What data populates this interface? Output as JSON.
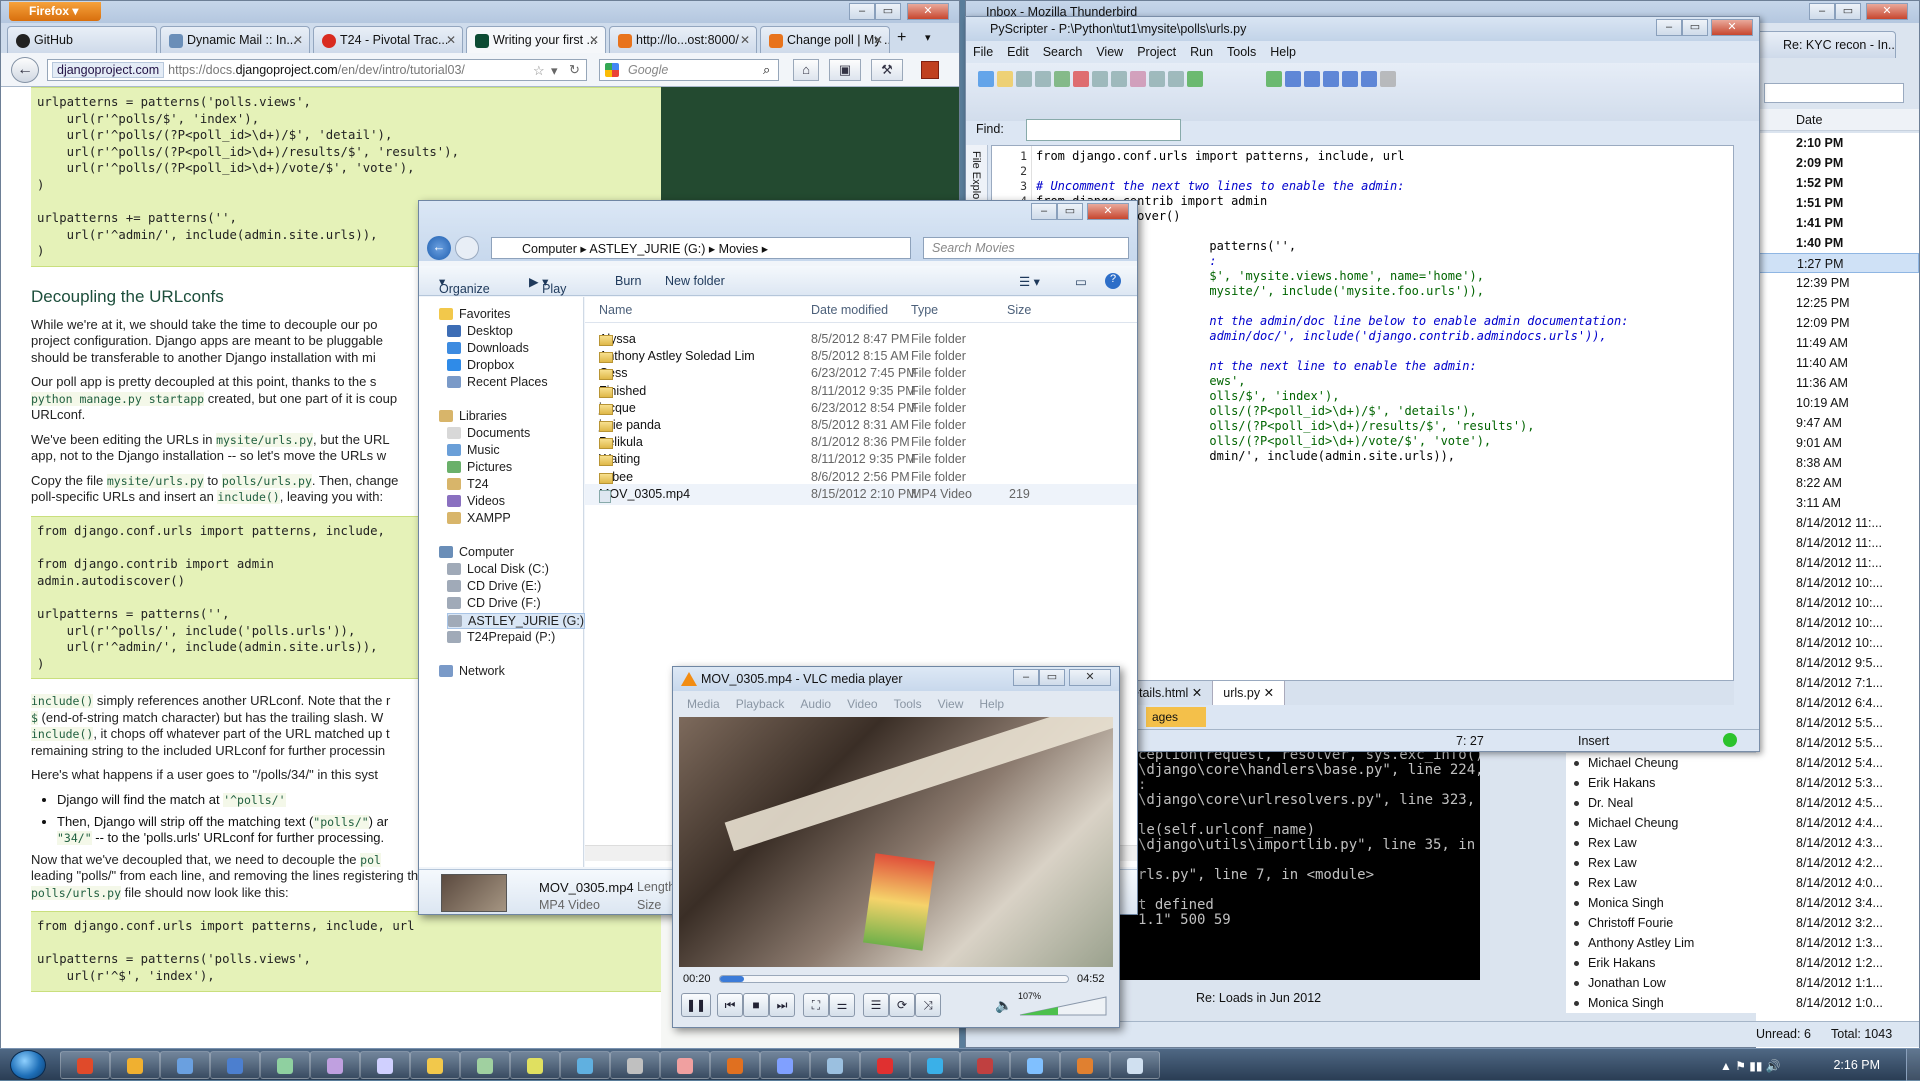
{
  "firefox": {
    "menu_label": "Firefox",
    "tabs": [
      {
        "label": "GitHub",
        "color": "#222222"
      },
      {
        "label": "Dynamic Mail :: In...",
        "color": "#6a8eb8"
      },
      {
        "label": "T24 - Pivotal Trac...",
        "color": "#d92b1f"
      },
      {
        "label": "Writing your first ...",
        "color": "#0c4b33"
      },
      {
        "label": "http://lo...ost:8000/",
        "color": "#e8731c"
      },
      {
        "label": "Change poll | My ...",
        "color": "#e8731c"
      }
    ],
    "url_site": "djangoproject.com",
    "url_prefix": "https://docs.",
    "url_host": "djangoproject.com",
    "url_path": "/en/dev/intro/tutorial03/",
    "search_placeholder": "Google"
  },
  "doc": {
    "code1": "urlpatterns = patterns('polls.views',\n    url(r'^polls/$', 'index'),\n    url(r'^polls/(?P<poll_id>\\d+)/$', 'detail'),\n    url(r'^polls/(?P<poll_id>\\d+)/results/$', 'results'),\n    url(r'^polls/(?P<poll_id>\\d+)/vote/$', 'vote'),\n)\n\nurlpatterns += patterns('',\n    url(r'^admin/', include(admin.site.urls)),\n)",
    "heading": "Decoupling the URLconfs",
    "p1": "While we're at it, we should take the time to decouple our po",
    "p1b": "project configuration. Django apps are meant to be pluggable",
    "p1c": "should be transferable to another Django installation with mi",
    "p2": "Our poll app is pretty decoupled at this point, thanks to the s",
    "p2b_code": "python manage.py startapp",
    "p2b": " created, but one part of it is coup",
    "p2c": "URLconf.",
    "p3": "We've been editing the URLs in ",
    "p3_code": "mysite/urls.py",
    "p3b": ", but the URL",
    "p3c": "app, not to the Django installation -- so let's move the URLs w",
    "p4": "Copy the file ",
    "p4_code1": "mysite/urls.py",
    "p4_mid": " to ",
    "p4_code2": "polls/urls.py",
    "p4b": ". Then, change",
    "p4c": "poll-specific URLs and insert an ",
    "p4_code3": "include()",
    "p4d": ", leaving you with:",
    "code2": "from django.conf.urls import patterns, include,\n\nfrom django.contrib import admin\nadmin.autodiscover()\n\nurlpatterns = patterns('',\n    url(r'^polls/', include('polls.urls')),\n    url(r'^admin/', include(admin.site.urls)),\n)",
    "p5_code": "include()",
    "p5": " simply references another URLconf. Note that the r",
    "p5b_code": "$",
    "p5b": " (end-of-string match character) but has the trailing slash. W",
    "p5c_code": "include()",
    "p5c": ", it chops off whatever part of the URL matched up t",
    "p5d": "remaining string to the included URLconf for further processin",
    "p6": "Here's what happens if a user goes to \"/polls/34/\" in this syst",
    "li1": "Django will find the match at ",
    "li1_code": "'^polls/'",
    "li2": "Then, Django will strip off the matching text (",
    "li2_code": "\"polls/\"",
    "li2b": ") ar",
    "li2c_code": "\"34/\"",
    "li2c": " -- to the 'polls.urls' URLconf for further processing.",
    "p7": "Now that we've decoupled that, we need to decouple the ",
    "p7_code": "pol",
    "p7b": "leading \"polls/\" from each line, and removing the lines registering the admin site. Your",
    "p7c_code": "polls/urls.py",
    "p7c": " file should now look like this:",
    "code3": "from django.conf.urls import patterns, include, url\n\nurlpatterns = patterns('polls.views',\n    url(r'^$', 'index'),"
  },
  "thunderbird": {
    "title": "Inbox - Mozilla Thunderbird",
    "tab2": "Re: KYC recon - In...",
    "date_header": "Date",
    "dates": [
      {
        "t": "2:10 PM",
        "bold": true
      },
      {
        "t": "2:09 PM",
        "bold": true
      },
      {
        "t": "1:52 PM",
        "bold": true
      },
      {
        "t": "1:51 PM",
        "bold": true
      },
      {
        "t": "1:41 PM",
        "bold": true
      },
      {
        "t": "1:40 PM",
        "bold": true
      },
      {
        "t": "1:27 PM",
        "bold": false,
        "sel": true
      },
      {
        "t": "12:39 PM"
      },
      {
        "t": "12:25 PM"
      },
      {
        "t": "12:09 PM"
      },
      {
        "t": "11:49 AM"
      },
      {
        "t": "11:40 AM"
      },
      {
        "t": "11:36 AM"
      },
      {
        "t": "10:19 AM"
      },
      {
        "t": "9:47 AM"
      },
      {
        "t": "9:01 AM"
      },
      {
        "t": "8:38 AM"
      },
      {
        "t": "8:22 AM"
      },
      {
        "t": "3:11 AM"
      },
      {
        "t": "8/14/2012 11:..."
      },
      {
        "t": "8/14/2012 11:..."
      },
      {
        "t": "8/14/2012 11:..."
      },
      {
        "t": "8/14/2012 10:..."
      },
      {
        "t": "8/14/2012 10:..."
      },
      {
        "t": "8/14/2012 10:..."
      },
      {
        "t": "8/14/2012 10:..."
      },
      {
        "t": "8/14/2012 9:5..."
      },
      {
        "t": "8/14/2012 7:1..."
      },
      {
        "t": "8/14/2012 6:4..."
      },
      {
        "t": "8/14/2012 5:5..."
      },
      {
        "t": "8/14/2012 5:5..."
      },
      {
        "t": "8/14/2012 5:4..."
      },
      {
        "t": "8/14/2012 5:3..."
      },
      {
        "t": "8/14/2012 4:5..."
      },
      {
        "t": "8/14/2012 4:4..."
      },
      {
        "t": "8/14/2012 4:3..."
      },
      {
        "t": "8/14/2012 4:2..."
      },
      {
        "t": "8/14/2012 4:0..."
      },
      {
        "t": "8/14/2012 3:4..."
      },
      {
        "t": "8/14/2012 3:2..."
      },
      {
        "t": "8/14/2012 1:3..."
      },
      {
        "t": "8/14/2012 1:2..."
      },
      {
        "t": "8/14/2012 1:1..."
      },
      {
        "t": "8/14/2012 1:0..."
      }
    ],
    "senders": [
      "Michael Cheung",
      "Erik Hakans",
      "Dr. Neal",
      "Michael Cheung",
      "Rex Law",
      "Rex Law",
      "Rex Law",
      "Monica Singh",
      "Christoff Fourie",
      "Anthony Astley Lim",
      "Erik Hakans",
      "Jonathan Low",
      "Monica Singh"
    ],
    "subject_row": "Re: Loads in Jun 2012",
    "unread": "Unread: 6",
    "total": "Total: 1043"
  },
  "terminal": {
    "text": "ception(request, resolver, sys.exc_info())\n\\django\\core\\handlers\\base.py\", line 224, i\n:\n\\django\\core\\urlresolvers.py\", line 323, in\n\nle(self.urlconf_name)\n\\django\\utils\\importlib.py\", line 35, in im\n\nrls.py\", line 7, in <module>\n\nt defined\n1.1\" 500 59"
  },
  "pyscripter": {
    "title": "PyScripter - P:\\Python\\tut1\\mysite\\polls\\urls.py",
    "menu": [
      "File",
      "Edit",
      "Search",
      "View",
      "Project",
      "Run",
      "Tools",
      "Help"
    ],
    "find_label": "Find:",
    "side_label": "File Explo",
    "line_numbers": [
      "1",
      "2",
      "3",
      "4",
      "5"
    ],
    "code_lines": [
      {
        "cls": "",
        "t": "from django.conf.urls import patterns, include, url"
      },
      {
        "cls": "",
        "t": ""
      },
      {
        "cls": "cm",
        "t": "# Uncomment the next two lines to enable the admin:"
      },
      {
        "cls": "",
        "t": "from django.contrib import admin"
      },
      {
        "cls": "",
        "t": "admin.autodiscover()"
      },
      {
        "cls": "",
        "t": ""
      },
      {
        "cls": "",
        "t": "                        patterns('',"
      },
      {
        "cls": "cm",
        "t": "                        :"
      },
      {
        "cls": "st",
        "t": "                        $', 'mysite.views.home', name='home'),"
      },
      {
        "cls": "st",
        "t": "                        mysite/', include('mysite.foo.urls')),"
      },
      {
        "cls": "",
        "t": ""
      },
      {
        "cls": "cm",
        "t": "                        nt the admin/doc line below to enable admin documentation:"
      },
      {
        "cls": "cm",
        "t": "                        admin/doc/', include('django.contrib.admindocs.urls')),"
      },
      {
        "cls": "",
        "t": ""
      },
      {
        "cls": "cm",
        "t": "                        nt the next line to enable the admin:"
      },
      {
        "cls": "st",
        "t": "                        ews',"
      },
      {
        "cls": "st",
        "t": "                        olls/$', 'index'),"
      },
      {
        "cls": "st",
        "t": "                        olls/(?P<poll_id>\\d+)/$', 'details'),"
      },
      {
        "cls": "st",
        "t": "                        olls/(?P<poll_id>\\d+)/results/$', 'results'),"
      },
      {
        "cls": "st",
        "t": "                        olls/(?P<poll_id>\\d+)/vote/$', 'vote'),"
      },
      {
        "cls": "",
        "t": "                        dmin/', include(admin.site.urls)),"
      },
      {
        "cls": "",
        "t": "                        "
      }
    ],
    "file_tabs": [
      "y",
      "views.py",
      "details.html",
      "urls.py"
    ],
    "bottom_tab": "ages",
    "cursor_pos": "7: 27",
    "mode": "Insert"
  },
  "explorer": {
    "path": [
      "Computer",
      "ASTLEY_JURIE (G:)",
      "Movies"
    ],
    "search_placeholder": "Search Movies",
    "commands": [
      "Organize",
      "Play",
      "Burn",
      "New folder"
    ],
    "nav": {
      "favorites": "Favorites",
      "fav_items": [
        "Desktop",
        "Downloads",
        "Dropbox",
        "Recent Places"
      ],
      "libraries": "Libraries",
      "lib_items": [
        "Documents",
        "Music",
        "Pictures",
        "T24",
        "Videos",
        "XAMPP"
      ],
      "computer": "Computer",
      "comp_items": [
        "Local Disk (C:)",
        "CD Drive (E:)",
        "CD Drive (F:)",
        "ASTLEY_JURIE (G:)",
        "T24Prepaid (P:)"
      ],
      "network": "Network"
    },
    "columns": [
      "Name",
      "Date modified",
      "Type",
      "Size"
    ],
    "files": [
      {
        "name": "Alyssa",
        "date": "8/5/2012 8:47 PM",
        "type": "File folder",
        "size": ""
      },
      {
        "name": "Anthony Astley Soledad Lim",
        "date": "8/5/2012 8:15 AM",
        "type": "File folder",
        "size": ""
      },
      {
        "name": "Cess",
        "date": "6/23/2012 7:45 PM",
        "type": "File folder",
        "size": ""
      },
      {
        "name": "Finished",
        "date": "8/11/2012 9:35 PM",
        "type": "File folder",
        "size": ""
      },
      {
        "name": "jacque",
        "date": "6/23/2012 8:54 PM",
        "type": "File folder",
        "size": ""
      },
      {
        "name": "jurie panda",
        "date": "8/5/2012 8:31 AM",
        "type": "File folder",
        "size": ""
      },
      {
        "name": "Pelikula",
        "date": "8/1/2012 8:36 PM",
        "type": "File folder",
        "size": ""
      },
      {
        "name": "Waiting",
        "date": "8/11/2012 9:35 PM",
        "type": "File folder",
        "size": ""
      },
      {
        "name": "yabee",
        "date": "8/6/2012 2:56 PM",
        "type": "File folder",
        "size": ""
      },
      {
        "name": "MOV_0305.mp4",
        "date": "8/15/2012 2:10 PM",
        "type": "MP4 Video",
        "size": "219"
      }
    ],
    "details_name": "MOV_0305.mp4",
    "details_type": "MP4 Video",
    "details_length": "Length",
    "details_size": "Size"
  },
  "vlc": {
    "title": "MOV_0305.mp4 - VLC media player",
    "menu": [
      "Media",
      "Playback",
      "Audio",
      "Video",
      "Tools",
      "View",
      "Help"
    ],
    "elapsed": "00:20",
    "duration": "04:52",
    "progress": 0.07,
    "volume": "107%"
  },
  "taskbar": {
    "clock": "2:16 PM",
    "apps": [
      "#e04a2a",
      "#f0b030",
      "#6aa0e0",
      "#4c7fcf",
      "#8fd0a0",
      "#c0a0e0",
      "#d0d0ff",
      "#f2c84b",
      "#a0d0a0",
      "#e0e060",
      "#60b0e0",
      "#c0c0c0",
      "#f0a0a0",
      "#e07020",
      "#80a0ff",
      "#9bc0e0",
      "#e03030",
      "#3ab0e8",
      "#c04040",
      "#80c0ff",
      "#e08030",
      "#d0e0f0"
    ]
  }
}
